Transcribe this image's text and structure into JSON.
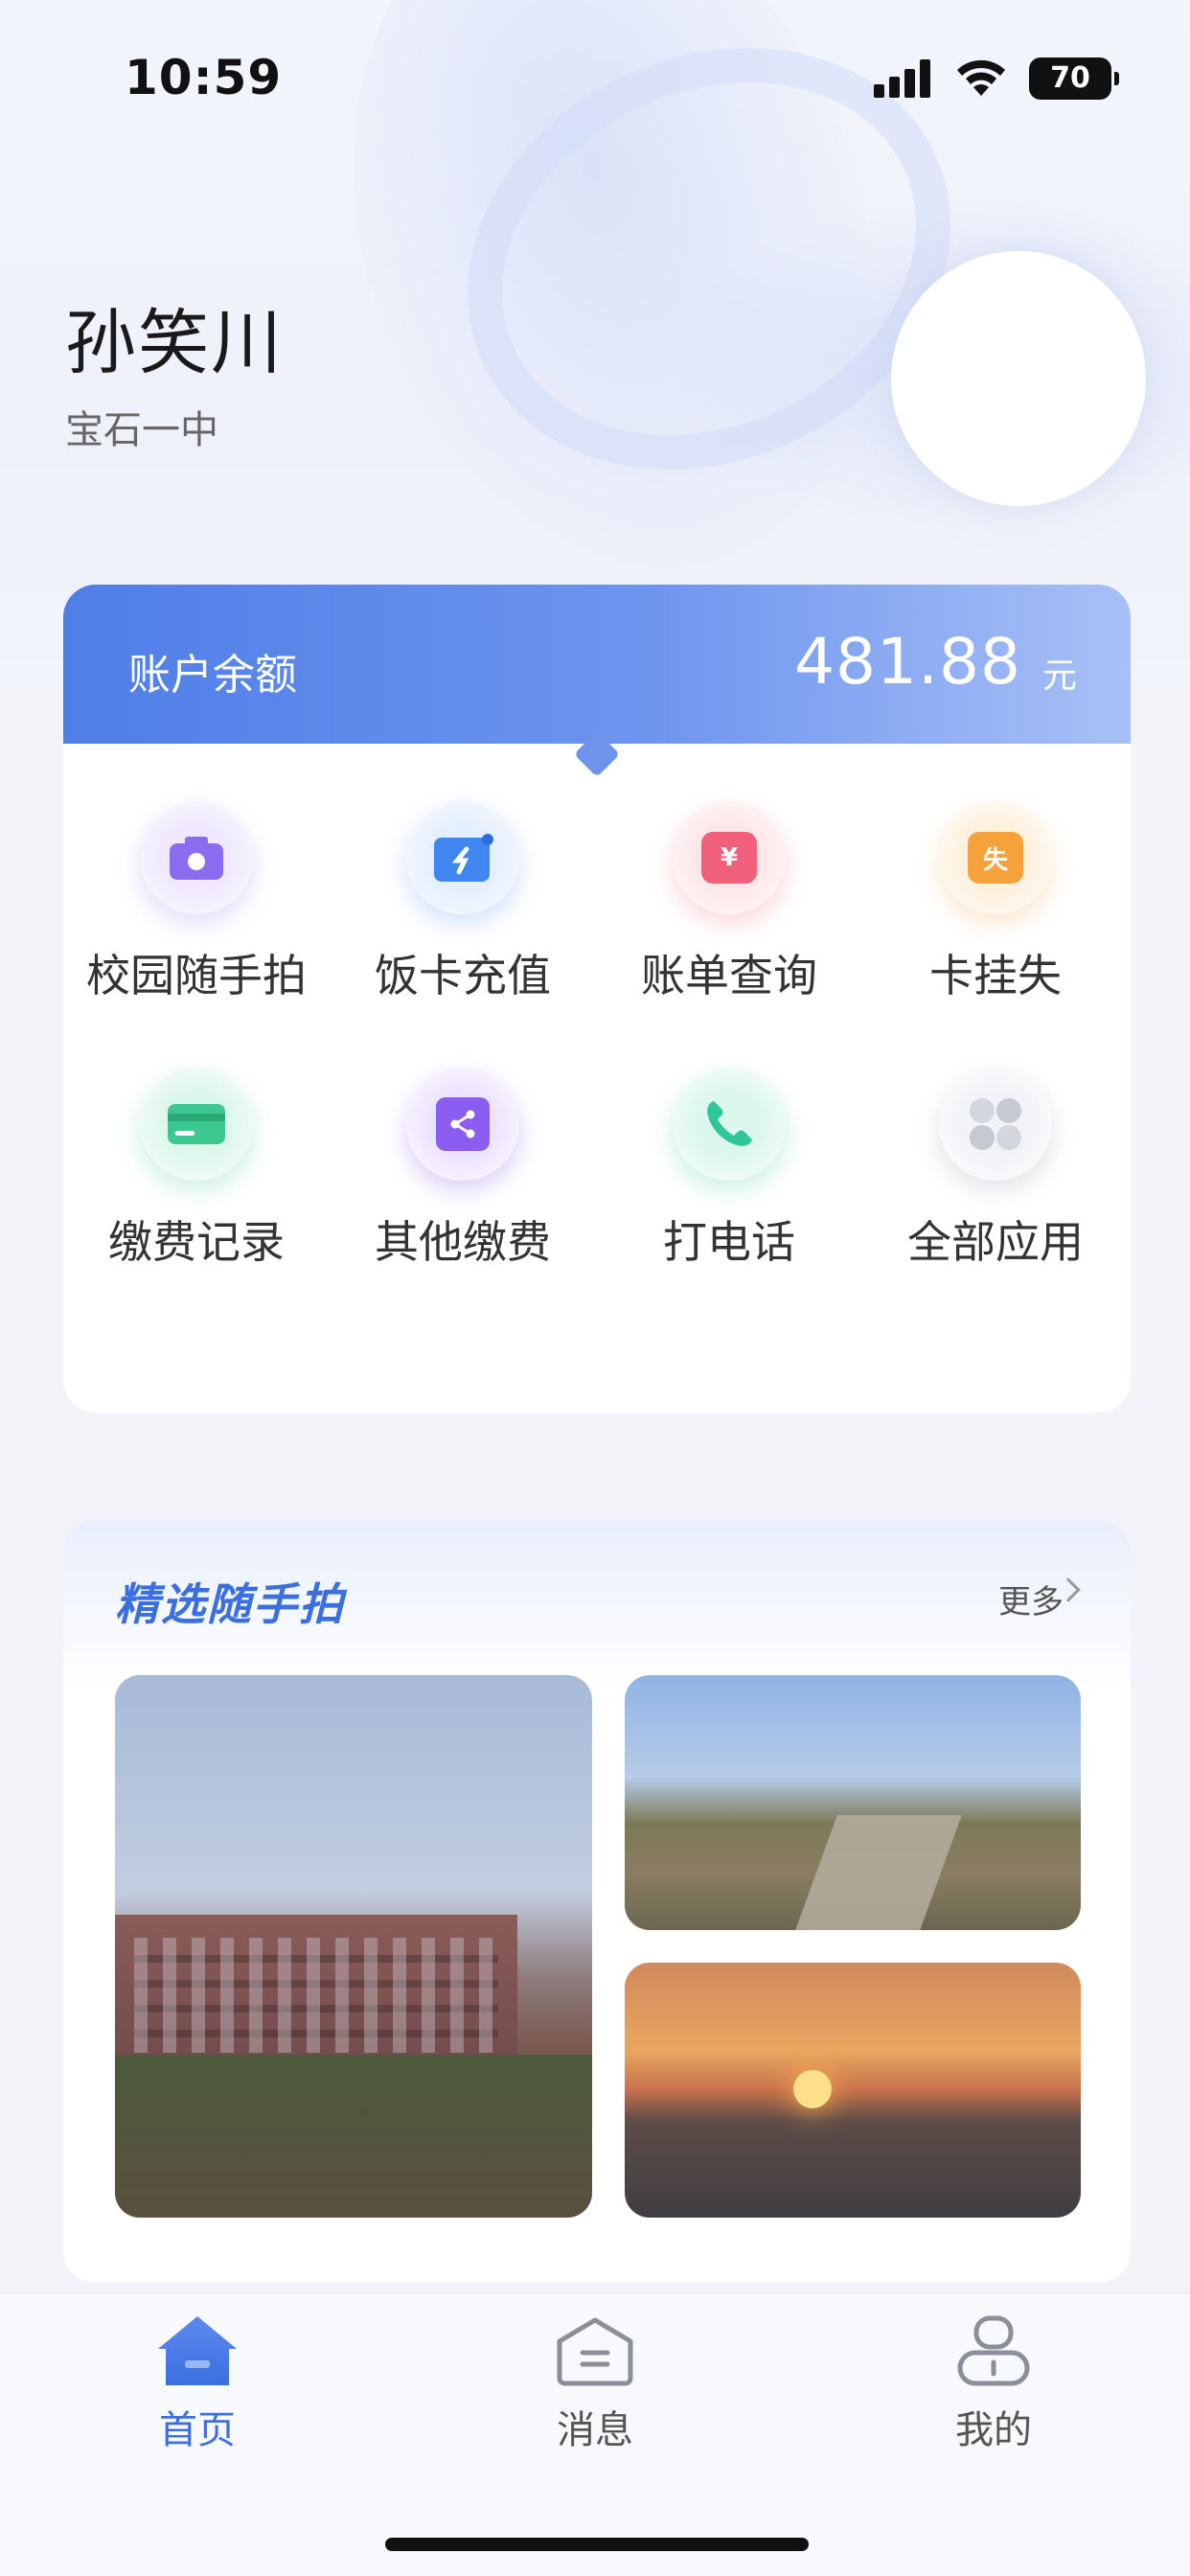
{
  "status_bar": {
    "time": "10:59",
    "battery": "70"
  },
  "profile": {
    "name": "孙笑川",
    "school": "宝石一中"
  },
  "account": {
    "label": "账户余额",
    "amount": "481.88",
    "unit": "元"
  },
  "apps": [
    {
      "label": "校园随手拍",
      "icon": "camera-icon",
      "color": "#8a6cf0"
    },
    {
      "label": "饭卡充值",
      "icon": "card-recharge-icon",
      "color": "#3f86f0"
    },
    {
      "label": "账单查询",
      "icon": "bill-yuan-icon",
      "color": "#f0607a",
      "glyph": "¥"
    },
    {
      "label": "卡挂失",
      "icon": "card-lost-icon",
      "color": "#f6a23c",
      "glyph": "失"
    },
    {
      "label": "缴费记录",
      "icon": "payment-record-icon",
      "color": "#3cc890"
    },
    {
      "label": "其他缴费",
      "icon": "share-payment-icon",
      "color": "#8a5cf0"
    },
    {
      "label": "打电话",
      "icon": "phone-icon",
      "color": "#2fc79a"
    },
    {
      "label": "全部应用",
      "icon": "all-apps-icon",
      "color": "#c9ccd6"
    }
  ],
  "featured": {
    "title": "精选随手拍",
    "more": "更多"
  },
  "tabs": [
    {
      "label": "首页",
      "icon": "home-icon",
      "active": true
    },
    {
      "label": "消息",
      "icon": "message-icon",
      "active": false
    },
    {
      "label": "我的",
      "icon": "profile-icon",
      "active": false
    }
  ],
  "colors": {
    "accent": "#3b6fe0",
    "balance_start": "#4e7ee8",
    "balance_end": "#a8c0f6"
  }
}
